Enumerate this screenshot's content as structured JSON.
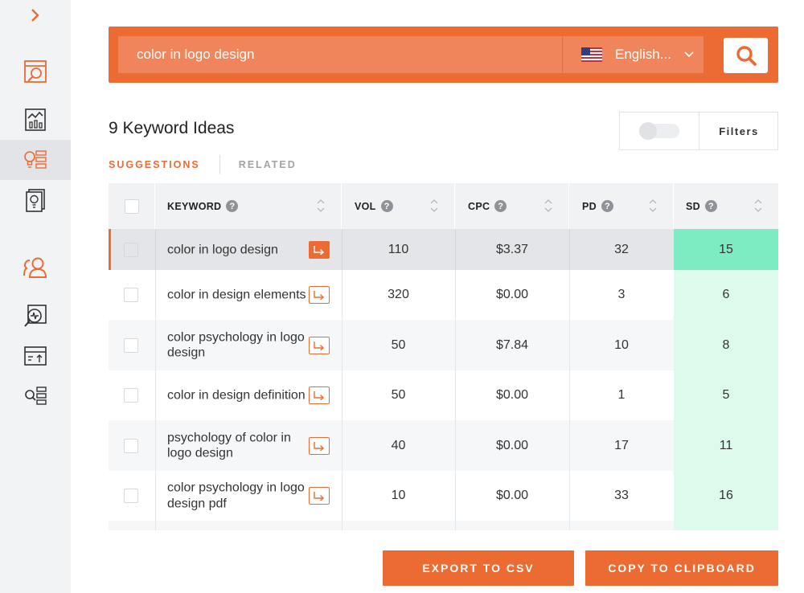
{
  "sidebar": {
    "items": [
      {
        "icon": "chevron-right-icon"
      },
      {
        "icon": "serp-search-icon"
      },
      {
        "icon": "analytics-chart-icon"
      },
      {
        "icon": "keyword-ideas-icon",
        "active": true
      },
      {
        "icon": "content-ideas-icon"
      },
      {
        "icon": "users-icon"
      },
      {
        "icon": "site-audit-icon"
      },
      {
        "icon": "rank-tracking-icon"
      },
      {
        "icon": "keyword-lists-icon"
      }
    ]
  },
  "search": {
    "value": "color in logo design",
    "language": "English...",
    "flag": "us-flag-icon"
  },
  "header": {
    "title": "9 Keyword Ideas",
    "filters_label": "Filters",
    "filters_toggle_on": false
  },
  "tabs": [
    {
      "label": "SUGGESTIONS",
      "active": true
    },
    {
      "label": "RELATED",
      "active": false
    }
  ],
  "table": {
    "columns": [
      {
        "label": "KEYWORD"
      },
      {
        "label": "VOL"
      },
      {
        "label": "CPC"
      },
      {
        "label": "PD"
      },
      {
        "label": "SD"
      }
    ],
    "rows": [
      {
        "keyword": "color in logo design",
        "vol": "110",
        "cpc": "$3.37",
        "pd": "32",
        "sd": "15",
        "selected": true
      },
      {
        "keyword": "color in design elements",
        "vol": "320",
        "cpc": "$0.00",
        "pd": "3",
        "sd": "6"
      },
      {
        "keyword": "color psychology in logo design",
        "vol": "50",
        "cpc": "$7.84",
        "pd": "10",
        "sd": "8"
      },
      {
        "keyword": "color in design definition",
        "vol": "50",
        "cpc": "$0.00",
        "pd": "1",
        "sd": "5"
      },
      {
        "keyword": "psychology of color in logo design",
        "vol": "40",
        "cpc": "$0.00",
        "pd": "17",
        "sd": "11"
      },
      {
        "keyword": "color psychology in logo design pdf",
        "vol": "10",
        "cpc": "$0.00",
        "pd": "33",
        "sd": "16"
      }
    ]
  },
  "footer": {
    "export_label": "EXPORT TO CSV",
    "copy_label": "COPY TO CLIPBOARD"
  },
  "colors": {
    "accent": "#ec6b33",
    "sd_highlight": "#7eecc2",
    "sd_light": "#dcfbec"
  }
}
